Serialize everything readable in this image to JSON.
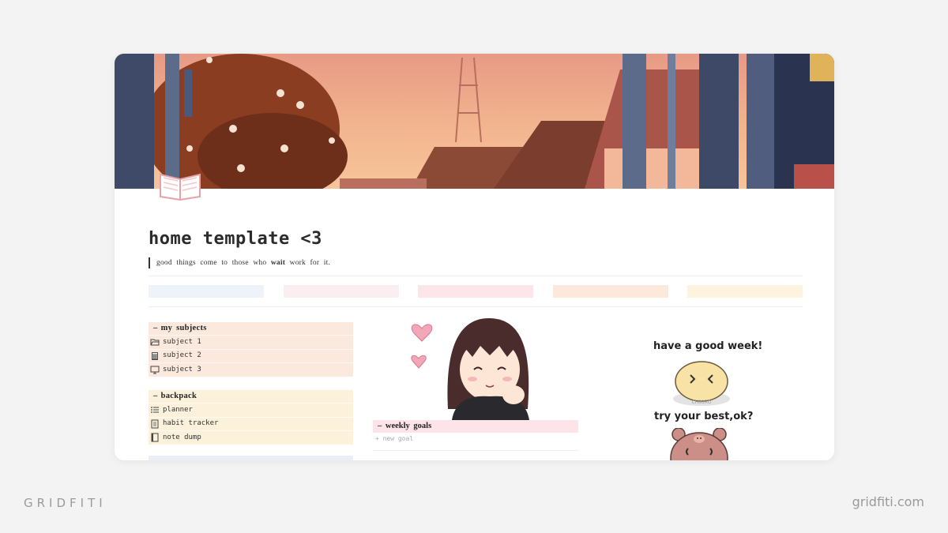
{
  "page": {
    "title": "home template <3",
    "quote": {
      "before": "good things come to those who",
      "emphasis": "wait",
      "after": "work for it."
    }
  },
  "palette": [
    "#eef2f9",
    "#fbeef1",
    "#fde6ea",
    "#fde9dc",
    "#fdf3de"
  ],
  "my_subjects": {
    "header": "my subjects",
    "items": [
      {
        "icon": "folder-icon",
        "label": "subject 1"
      },
      {
        "icon": "calculator-icon",
        "label": "subject 2"
      },
      {
        "icon": "monitor-icon",
        "label": "subject 3"
      }
    ]
  },
  "backpack": {
    "header": "backpack",
    "items": [
      {
        "icon": "list-icon",
        "label": "planner"
      },
      {
        "icon": "document-icon",
        "label": "habit tracker"
      },
      {
        "icon": "notebook-icon",
        "label": "note dump"
      }
    ]
  },
  "weekly_goals": {
    "header": "weekly goals",
    "new_item": "new goal"
  },
  "stickers": {
    "line1": "have a good week!",
    "line2": "try your best,ok?",
    "bun_tag": "CHIKIRO"
  },
  "footer": {
    "brand_left": "GRIDFITI",
    "brand_right": "gridfiti.com"
  }
}
